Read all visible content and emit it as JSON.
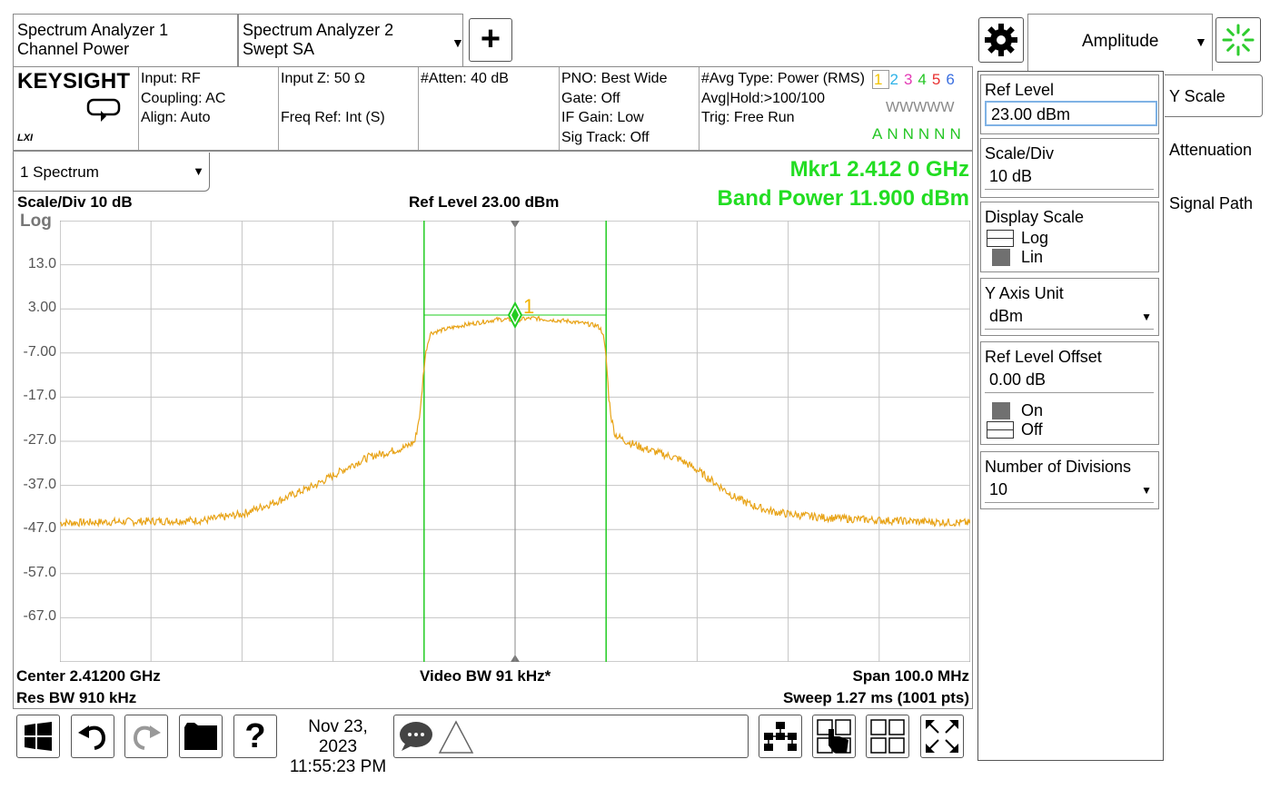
{
  "tabs": [
    {
      "line1": "Spectrum Analyzer 1",
      "line2": "Channel Power"
    },
    {
      "line1": "Spectrum Analyzer 2",
      "line2": "Swept SA"
    }
  ],
  "info": {
    "brand": "KEYSIGHT",
    "lxi": "LXI",
    "col1": [
      "Input: RF",
      "Coupling: AC",
      "Align: Auto"
    ],
    "col2": [
      "Input Z: 50 Ω",
      "",
      "Freq Ref: Int (S)"
    ],
    "col3": [
      "#Atten: 40 dB"
    ],
    "col4": [
      "PNO: Best Wide",
      "Gate: Off",
      "IF Gain: Low",
      "Sig Track: Off"
    ],
    "col5": [
      "#Avg Type: Power (RMS)",
      "Avg|Hold:>100/100",
      "Trig: Free Run"
    ],
    "traces": [
      "1",
      "2",
      "3",
      "4",
      "5",
      "6"
    ],
    "trace_colors": [
      "#f2c300",
      "#2fb3e8",
      "#e33cb5",
      "#24c624",
      "#e83030",
      "#3b6fe0"
    ],
    "trace_types": "WWWWW",
    "trace_modes": "ANNNNN"
  },
  "window": {
    "selector": "1 Spectrum",
    "scale_div": "Scale/Div 10 dB",
    "ref_level": "Ref Level 23.00 dBm",
    "scale_type": "Log",
    "marker": "Mkr1  2.412 0 GHz",
    "band_power": "Band Power 11.900 dBm",
    "center": "Center 2.41200 GHz",
    "res_bw": "Res BW 910 kHz",
    "video_bw": "Video BW 91 kHz*",
    "span": "Span 100.0 MHz",
    "sweep": "Sweep 1.27 ms (1001 pts)",
    "marker_label": "1"
  },
  "chart_data": {
    "type": "line",
    "ytick_labels": [
      "13.0",
      "3.00",
      "-7.00",
      "-17.0",
      "-27.0",
      "-37.0",
      "-47.0",
      "-57.0",
      "-67.0"
    ],
    "ylim": [
      -77,
      23
    ],
    "xlim": [
      2362,
      2462
    ],
    "x_unit": "MHz",
    "y_unit": "dBm",
    "grid": true,
    "trace_color": "#e8a317",
    "channel_lines_color": "#22cc22",
    "channel_edges": [
      2402,
      2422
    ],
    "marker": {
      "x": 2412,
      "y": 1.6
    },
    "series": [
      {
        "x": [
          2362,
          2370,
          2378,
          2382,
          2386,
          2390,
          2394,
          2396,
          2398,
          2400,
          2401,
          2401.6,
          2402,
          2402.3,
          2402.7,
          2404,
          2406,
          2408,
          2410,
          2412,
          2414,
          2416,
          2418,
          2419.5,
          2421,
          2421.6,
          2422,
          2422.3,
          2422.6,
          2423,
          2424,
          2426,
          2428,
          2430,
          2432,
          2434,
          2436,
          2438,
          2440,
          2442,
          2446,
          2452,
          2458,
          2462
        ],
        "values": [
          -45.5,
          -45.2,
          -44.9,
          -43.5,
          -40.5,
          -37,
          -32.5,
          -30.5,
          -29.5,
          -28.3,
          -27.0,
          -20,
          -10,
          -5.5,
          -2.5,
          -1.8,
          -0.8,
          -0.1,
          0.6,
          0.5,
          0.9,
          0.5,
          0.2,
          -0.3,
          -0.8,
          -2,
          -8,
          -17,
          -22,
          -25.5,
          -26.8,
          -28.5,
          -29.8,
          -31,
          -33.5,
          -36.5,
          -39.5,
          -41.5,
          -42.8,
          -43.5,
          -44.3,
          -44.9,
          -45.3,
          -45.5
        ]
      }
    ]
  },
  "toolbar": {
    "date": "Nov 23, 2023",
    "time": "11:55:23 PM"
  },
  "panel": {
    "tab_label": "Amplitude",
    "ref_level_label": "Ref Level",
    "ref_level_value": "23.00 dBm",
    "scale_div_label": "Scale/Div",
    "scale_div_value": "10 dB",
    "display_scale_label": "Display Scale",
    "display_scale_options": [
      "Log",
      "Lin"
    ],
    "y_axis_unit_label": "Y Axis Unit",
    "y_axis_unit_value": "dBm",
    "ref_offset_label": "Ref Level Offset",
    "ref_offset_value": "0.00 dB",
    "ref_offset_options": [
      "On",
      "Off"
    ],
    "num_div_label": "Number of Divisions",
    "num_div_value": "10",
    "side_tabs": [
      "Y Scale",
      "Attenuation",
      "Signal Path"
    ]
  }
}
